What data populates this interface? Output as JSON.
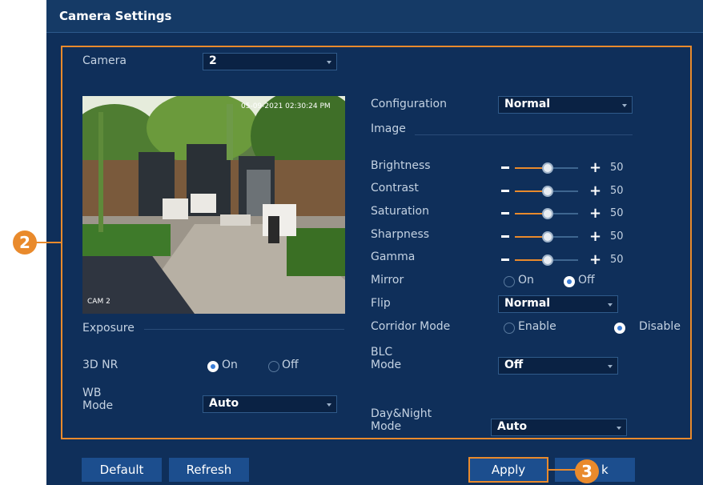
{
  "window": {
    "title": "Camera Settings"
  },
  "camera": {
    "label": "Camera",
    "value": "2"
  },
  "preview": {
    "timestamp": "05-09-2021 02:30:24 PM",
    "channel_label": "CAM 2"
  },
  "left": {
    "exposure_label": "Exposure",
    "nr": {
      "label": "3D NR",
      "on_label": "On",
      "off_label": "Off",
      "selected": "On"
    },
    "wb": {
      "label_line1": "WB",
      "label_line2": "Mode",
      "value": "Auto"
    }
  },
  "right": {
    "configuration": {
      "label": "Configuration",
      "value": "Normal"
    },
    "image_label": "Image",
    "sliders": [
      {
        "label": "Brightness",
        "value": "50",
        "level": 50
      },
      {
        "label": "Contrast",
        "value": "50",
        "level": 50
      },
      {
        "label": "Saturation",
        "value": "50",
        "level": 50
      },
      {
        "label": "Sharpness",
        "value": "50",
        "level": 50
      },
      {
        "label": "Gamma",
        "value": "50",
        "level": 50
      }
    ],
    "mirror": {
      "label": "Mirror",
      "on_label": "On",
      "off_label": "Off",
      "selected": "Off"
    },
    "flip": {
      "label": "Flip",
      "value": "Normal"
    },
    "corridor": {
      "label": "Corridor Mode",
      "enable_label": "Enable",
      "disable_label": "Disable",
      "selected": "Disable"
    },
    "blc": {
      "label_line1": "BLC",
      "label_line2": "Mode",
      "value": "Off"
    },
    "daynight": {
      "label_line1": "Day&Night",
      "label_line2": "Mode",
      "value": "Auto"
    }
  },
  "buttons": {
    "default": "Default",
    "refresh": "Refresh",
    "apply": "Apply",
    "back_partial": "k"
  },
  "callouts": {
    "panel": "2",
    "apply": "3"
  },
  "colors": {
    "accent": "#e98a2c",
    "background": "#0f2f5a",
    "button": "#1c4e8e"
  },
  "icons": {
    "dropdown": "chevron-down-icon",
    "slider_minus": "minus-icon",
    "slider_plus": "plus-icon"
  }
}
